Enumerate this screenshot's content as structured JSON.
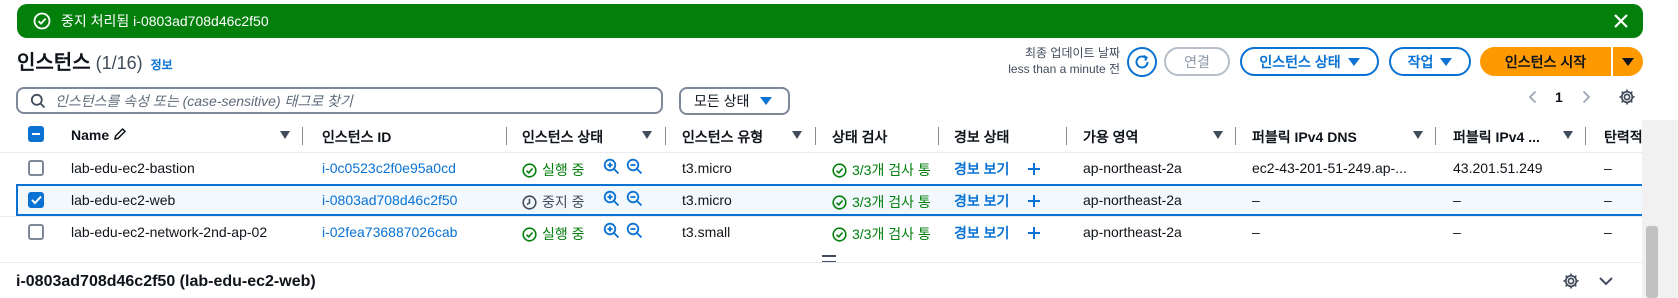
{
  "flash": {
    "message": "중지 처리됨 i-0803ad708d46c2f50",
    "icons": {
      "status": "check-circle-icon",
      "close": "close-icon"
    }
  },
  "header": {
    "title": "인스턴스",
    "count": "(1/16)",
    "info": "정보",
    "last_updated_label": "최종 업데이트 날짜",
    "last_updated_value": "less than a minute 전",
    "connect": "연결",
    "instance_state": "인스턴스 상태",
    "actions": "작업",
    "launch": "인스턴스 시작"
  },
  "filter": {
    "search_placeholder": "인스턴스를 속성 또는 (case-sensitive) 태그로 찾기",
    "state_select": "모든 상태"
  },
  "pagination": {
    "current_page": "1"
  },
  "table": {
    "columns": [
      "Name",
      "인스턴스 ID",
      "인스턴스 상태",
      "인스턴스 유형",
      "상태 검사",
      "경보 상태",
      "가용 영역",
      "퍼블릭 IPv4 DNS",
      "퍼블릭 IPv4 ...",
      "탄력적"
    ],
    "rows": [
      {
        "name": "lab-edu-ec2-bastion",
        "id": "i-0c0523c2f0e95a0cd",
        "state": "실행 중",
        "state_kind": "running",
        "type": "t3.micro",
        "check": "3/3개 검사 통",
        "alarm": "경보 보기",
        "az": "ap-northeast-2a",
        "dns": "ec2-43-201-51-249.ap-...",
        "ip": "43.201.51.249",
        "eip": "–",
        "selected": false
      },
      {
        "name": "lab-edu-ec2-web",
        "id": "i-0803ad708d46c2f50",
        "state": "중지 중",
        "state_kind": "stopping",
        "type": "t3.micro",
        "check": "3/3개 검사 통",
        "alarm": "경보 보기",
        "az": "ap-northeast-2a",
        "dns": "–",
        "ip": "–",
        "eip": "–",
        "selected": true
      },
      {
        "name": "lab-edu-ec2-network-2nd-ap-02",
        "id": "i-02fea736887026cab",
        "state": "실행 중",
        "state_kind": "running",
        "type": "t3.small",
        "check": "3/3개 검사 통",
        "alarm": "경보 보기",
        "az": "ap-northeast-2a",
        "dns": "–",
        "ip": "–",
        "eip": "–",
        "selected": false
      }
    ]
  },
  "detail": {
    "title": "i-0803ad708d46c2f50 (lab-edu-ec2-web)"
  },
  "colors": {
    "success": "#037f0c",
    "link": "#0972d3",
    "primary": "#ff9900",
    "border": "#7d8998"
  }
}
